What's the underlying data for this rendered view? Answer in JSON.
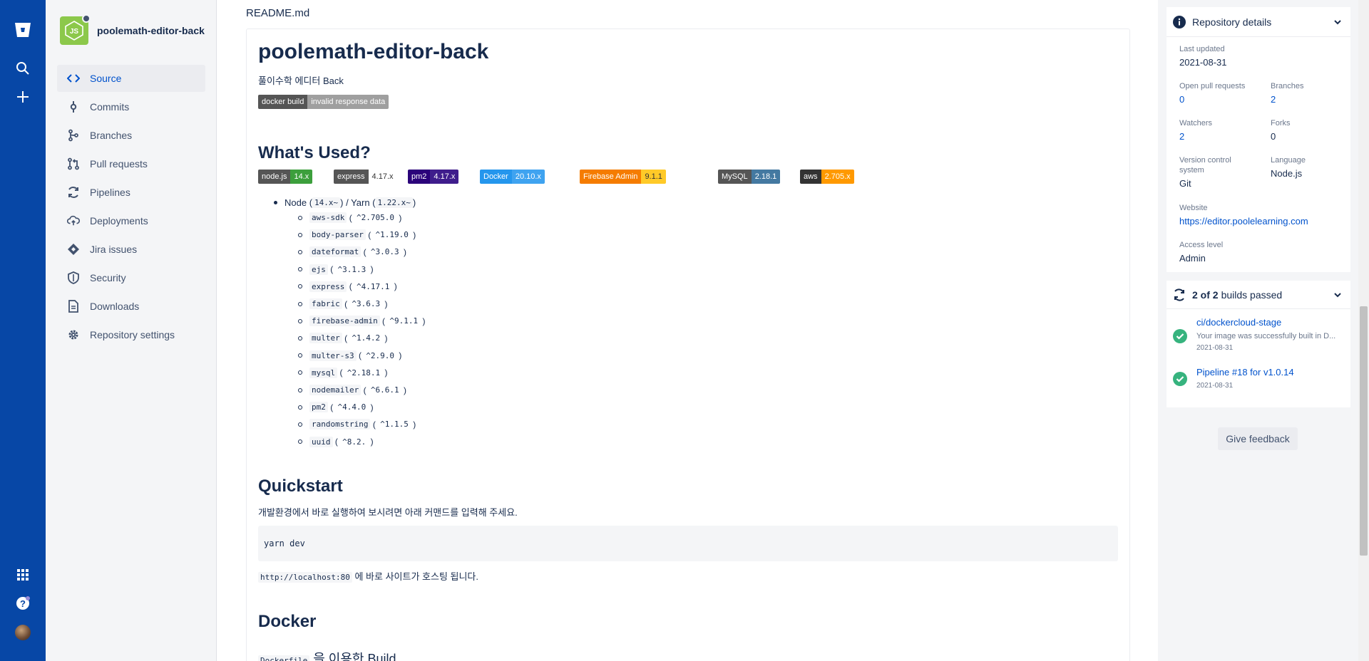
{
  "sidebar": {
    "repo_name": "poolemath-editor-back",
    "items": [
      {
        "label": "Source"
      },
      {
        "label": "Commits"
      },
      {
        "label": "Branches"
      },
      {
        "label": "Pull requests"
      },
      {
        "label": "Pipelines"
      },
      {
        "label": "Deployments"
      },
      {
        "label": "Jira issues"
      },
      {
        "label": "Security"
      },
      {
        "label": "Downloads"
      },
      {
        "label": "Repository settings"
      }
    ]
  },
  "readme": {
    "file_title": "README.md",
    "h1": "poolemath-editor-back",
    "subtitle": "풀이수학 에디터 Back",
    "docker_badge": {
      "left": "docker build",
      "right": "invalid response data"
    },
    "whats_used": "What's Used?",
    "badges": [
      {
        "left": "node.js",
        "right": "14.x"
      },
      {
        "left": "express",
        "right": "4.17.x"
      },
      {
        "left": "pm2",
        "right": "4.17.x"
      },
      {
        "left": "Docker",
        "right": "20.10.x"
      },
      {
        "left": "Firebase Admin",
        "right": "9.1.1"
      },
      {
        "left": "MySQL",
        "right": "2.18.1"
      },
      {
        "left": "aws",
        "right": "2.705.x"
      }
    ],
    "node_line": {
      "prefix": "Node (",
      "node_ver": "14.x~",
      "mid": ") / Yarn (",
      "yarn_ver": "1.22.x~",
      "suffix": ")"
    },
    "deps": [
      {
        "name": "aws-sdk",
        "ver": "^2.705.0"
      },
      {
        "name": "body-parser",
        "ver": "^1.19.0"
      },
      {
        "name": "dateformat",
        "ver": "^3.0.3"
      },
      {
        "name": "ejs",
        "ver": "^3.1.3"
      },
      {
        "name": "express",
        "ver": "^4.17.1"
      },
      {
        "name": "fabric",
        "ver": "^3.6.3"
      },
      {
        "name": "firebase-admin",
        "ver": "^9.1.1"
      },
      {
        "name": "multer",
        "ver": "^1.4.2"
      },
      {
        "name": "multer-s3",
        "ver": "^2.9.0"
      },
      {
        "name": "mysql",
        "ver": "^2.18.1"
      },
      {
        "name": "nodemailer",
        "ver": "^6.6.1"
      },
      {
        "name": "pm2",
        "ver": "^4.4.0"
      },
      {
        "name": "randomstring",
        "ver": "^1.1.5"
      },
      {
        "name": "uuid",
        "ver": "^8.2."
      }
    ],
    "quickstart": "Quickstart",
    "quickstart_desc": "개발환경에서 바로 실행하여 보시려면 아래 커맨드를 입력해 주세요.",
    "code": "yarn dev",
    "host_code": "http://localhost:80",
    "host_text": "에 바로 사이트가 호스팅 됩니다.",
    "docker_h": "Docker",
    "docker_sub_code": "Dockerfile",
    "docker_sub_text": "을 이용한 Build"
  },
  "details": {
    "header": "Repository details",
    "last_updated_label": "Last updated",
    "last_updated": "2021-08-31",
    "open_pr_label": "Open pull requests",
    "open_pr": "0",
    "branches_label": "Branches",
    "branches": "2",
    "watchers_label": "Watchers",
    "watchers": "2",
    "forks_label": "Forks",
    "forks": "0",
    "vcs_label": "Version control system",
    "vcs": "Git",
    "language_label": "Language",
    "language": "Node.js",
    "website_label": "Website",
    "website": "https://editor.poolelearning.com",
    "access_label": "Access level",
    "access": "Admin"
  },
  "builds": {
    "count": "2 of 2",
    "label": "builds passed",
    "items": [
      {
        "title": "ci/dockercloud-stage",
        "desc": "Your image was successfully built in D...",
        "date": "2021-08-31"
      },
      {
        "title": "Pipeline #18 for v1.0.14",
        "desc": "",
        "date": "2021-08-31"
      }
    ]
  },
  "feedback": "Give feedback",
  "colors": {
    "rail": "#0747a6",
    "link": "#0052cc",
    "success": "#36b37e",
    "node_green": "#8cc84b"
  }
}
